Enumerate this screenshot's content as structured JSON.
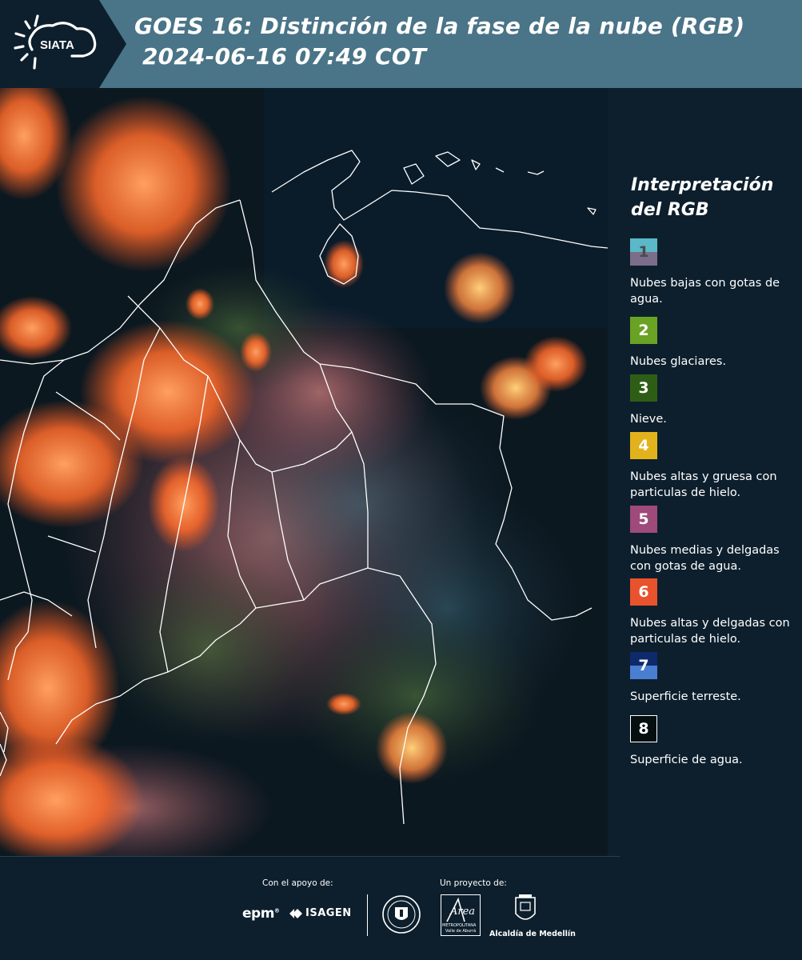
{
  "header": {
    "logo_text": "SIATA",
    "title": "GOES 16: Distinción de la fase de la nube (RGB)\n 2024-06-16 07:49 COT"
  },
  "colors": {
    "header_bg": "#4a7487",
    "panel_bg": "#0d1f2d",
    "logo_bg": "#0d1f2d",
    "cloud_orange": "#ff7a3a",
    "border_white": "#ffffff"
  },
  "legend": {
    "title": "Interpretación del RGB",
    "items": [
      {
        "number": "1",
        "label": "Nubes bajas con gotas de agua.",
        "color_top": "#5ab8c8",
        "color_bottom": "#7b6e8a",
        "text_color": "#4b4b4b"
      },
      {
        "number": "2",
        "label": "Nubes glaciares.",
        "color_top": "#6aa324",
        "color_bottom": "#6aa324",
        "text_color": "#ffffff"
      },
      {
        "number": "3",
        "label": "Nieve.",
        "color_top": "#2e5e16",
        "color_bottom": "#2e5e16",
        "text_color": "#ffffff"
      },
      {
        "number": "4",
        "label": "Nubes altas y gruesa con particulas de hielo.",
        "color_top": "#e1b21b",
        "color_bottom": "#e1b21b",
        "text_color": "#ffffff"
      },
      {
        "number": "5",
        "label": "Nubes medias y delgadas con gotas de agua.",
        "color_top": "#9e4a7a",
        "color_bottom": "#9e4a7a",
        "text_color": "#ffffff"
      },
      {
        "number": "6",
        "label": "Nubes altas y delgadas con particulas de hielo.",
        "color_top": "#e8522c",
        "color_bottom": "#e8522c",
        "text_color": "#ffffff"
      },
      {
        "number": "7",
        "label": "Superficie terreste.",
        "color_top": "#0f2a6a",
        "color_bottom": "#4a7ed1",
        "text_color": "#ffffff"
      },
      {
        "number": "8",
        "label": "Superficie de agua.",
        "color_top": "#050f0f",
        "color_bottom": "#050f0f",
        "text_color": "#ffffff"
      }
    ]
  },
  "footer": {
    "support_caption": "Con el apoyo de:",
    "project_caption": "Un proyecto de:",
    "epm_text": "epm",
    "isagen_text": "ISAGEN",
    "area_text": "Área",
    "area_subtext": "METROPOLITANA",
    "area_subtext2": "Valle de Aburrá",
    "alcaldia_text": "Alcaldía de Medellín"
  }
}
